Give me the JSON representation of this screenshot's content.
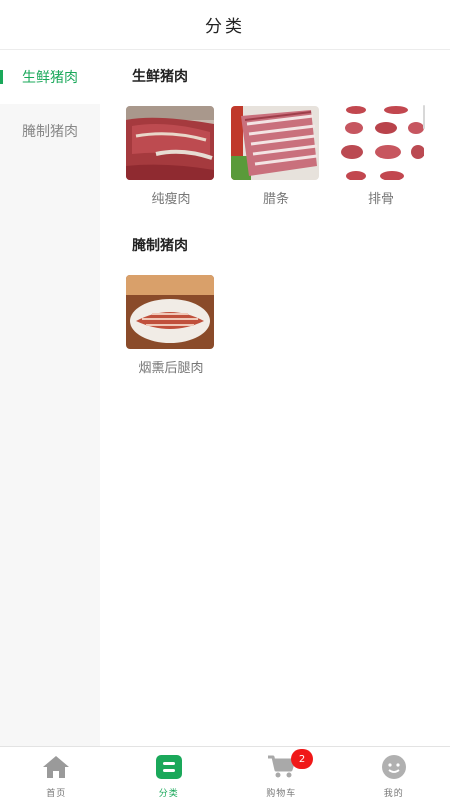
{
  "header": {
    "title": "分类"
  },
  "sidebar": {
    "items": [
      {
        "label": "生鲜猪肉",
        "active": true
      },
      {
        "label": "腌制猪肉",
        "active": false
      }
    ]
  },
  "sections": [
    {
      "title": "生鲜猪肉",
      "products": [
        {
          "name": "纯瘦肉",
          "image": "lean-pork-photo"
        },
        {
          "name": "腊条",
          "image": "pork-strips-photo"
        },
        {
          "name": "排骨",
          "image": "pork-cuts-photo"
        }
      ]
    },
    {
      "title": "腌制猪肉",
      "products": [
        {
          "name": "烟熏后腿肉",
          "image": "smoked-ham-photo"
        }
      ]
    }
  ],
  "tabbar": {
    "items": [
      {
        "label": "首页",
        "icon": "home-icon"
      },
      {
        "label": "分类",
        "icon": "category-icon",
        "active": true
      },
      {
        "label": "购物车",
        "icon": "cart-icon",
        "badge": "2"
      },
      {
        "label": "我的",
        "icon": "profile-icon"
      }
    ]
  },
  "colors": {
    "accent": "#1aa85a",
    "badge": "#f01818"
  }
}
